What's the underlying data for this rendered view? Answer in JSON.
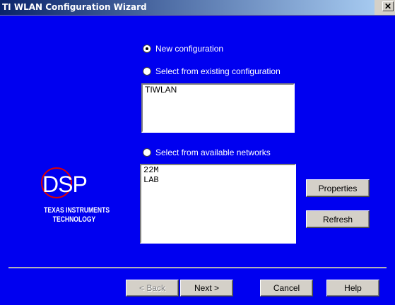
{
  "window": {
    "title": "TI WLAN Configuration Wizard",
    "close_glyph": "✕"
  },
  "options": {
    "new_config": "New configuration",
    "existing_config": "Select from existing configuration",
    "available_networks": "Select from available networks",
    "selected": "new_config"
  },
  "existing_list": [
    "TIWLAN"
  ],
  "network_list": [
    "22M",
    "LAB"
  ],
  "side_buttons": {
    "properties": "Properties",
    "refresh": "Refresh"
  },
  "logo": {
    "mark": "DSP",
    "line1": "TEXAS INSTRUMENTS",
    "line2": "TECHNOLOGY"
  },
  "footer": {
    "back": "< Back",
    "next": "Next >",
    "cancel": "Cancel",
    "help": "Help"
  },
  "colors": {
    "background": "#0000f0",
    "logo_circle": "#e00000"
  }
}
